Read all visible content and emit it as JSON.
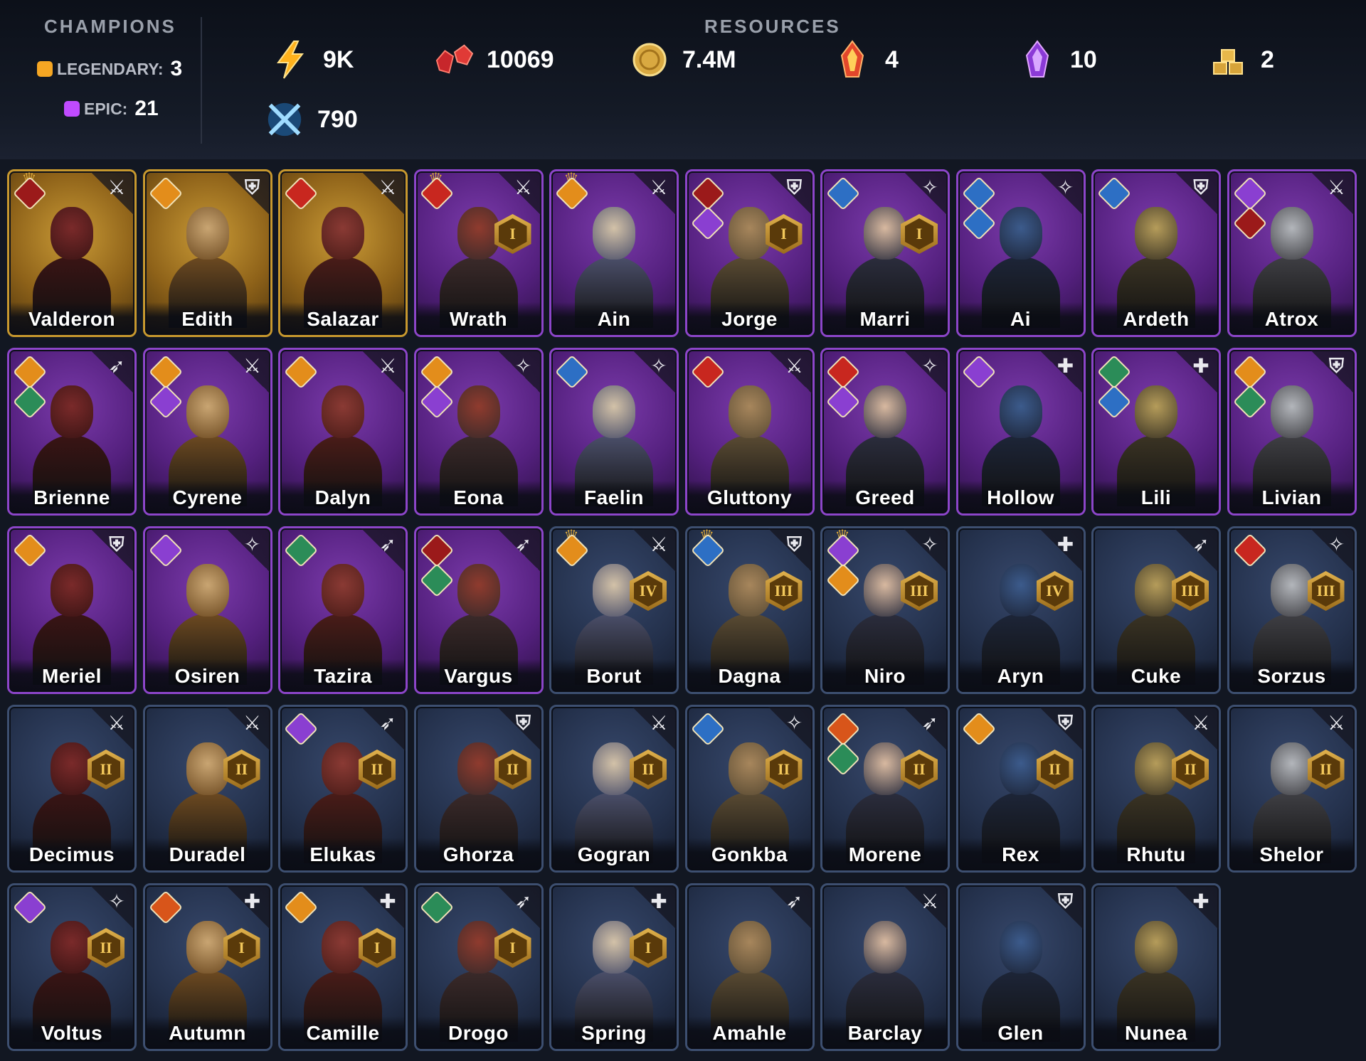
{
  "header": {
    "champions_title": "CHAMPIONS",
    "resources_title": "RESOURCES",
    "legendary": {
      "label": "LEGENDARY:",
      "count": "3",
      "color": "#f5a623"
    },
    "epic": {
      "label": "EPIC:",
      "count": "21",
      "color": "#c04bff"
    },
    "resources": [
      {
        "icon": "energy-bolt-icon",
        "value": "9K"
      },
      {
        "icon": "ruby-gems-icon",
        "value": "10069"
      },
      {
        "icon": "gold-coin-icon",
        "value": "7.4M"
      },
      {
        "icon": "fire-shard-icon",
        "value": "4"
      },
      {
        "icon": "void-shard-icon",
        "value": "10"
      },
      {
        "icon": "gold-bars-icon",
        "value": "2"
      },
      {
        "icon": "arena-swords-icon",
        "value": "790"
      }
    ]
  },
  "colors": {
    "legendary": "#c7982e",
    "epic": "#8c45c9",
    "rare": "#3d4f70"
  },
  "champions": [
    {
      "name": "Valderon",
      "rarity": "legendary",
      "role": "attack",
      "factions": [
        "red-demon"
      ],
      "crown": true,
      "rank": ""
    },
    {
      "name": "Edith",
      "rarity": "legendary",
      "role": "defense",
      "factions": [
        "orange"
      ],
      "crown": false,
      "rank": ""
    },
    {
      "name": "Salazar",
      "rarity": "legendary",
      "role": "attack",
      "factions": [
        "red"
      ],
      "crown": false,
      "rank": ""
    },
    {
      "name": "Wrath",
      "rarity": "epic",
      "role": "attack",
      "factions": [
        "red"
      ],
      "crown": true,
      "rank": "I"
    },
    {
      "name": "Ain",
      "rarity": "epic",
      "role": "attack",
      "factions": [
        "orange"
      ],
      "crown": true,
      "rank": ""
    },
    {
      "name": "Jorge",
      "rarity": "epic",
      "role": "defense",
      "factions": [
        "red-demon",
        "purple"
      ],
      "crown": false,
      "rank": "I"
    },
    {
      "name": "Marri",
      "rarity": "epic",
      "role": "support",
      "factions": [
        "blue"
      ],
      "crown": false,
      "rank": "I"
    },
    {
      "name": "Ai",
      "rarity": "epic",
      "role": "support",
      "factions": [
        "blue",
        "blue"
      ],
      "crown": false,
      "rank": ""
    },
    {
      "name": "Ardeth",
      "rarity": "epic",
      "role": "defense",
      "factions": [
        "blue"
      ],
      "crown": false,
      "rank": ""
    },
    {
      "name": "Atrox",
      "rarity": "epic",
      "role": "attack",
      "factions": [
        "purple",
        "red-demon"
      ],
      "crown": false,
      "rank": ""
    },
    {
      "name": "Brienne",
      "rarity": "epic",
      "role": "ranged",
      "factions": [
        "orange",
        "green"
      ],
      "crown": false,
      "rank": ""
    },
    {
      "name": "Cyrene",
      "rarity": "epic",
      "role": "attack",
      "factions": [
        "orange",
        "purple"
      ],
      "crown": false,
      "rank": ""
    },
    {
      "name": "Dalyn",
      "rarity": "epic",
      "role": "attack",
      "factions": [
        "orange"
      ],
      "crown": false,
      "rank": ""
    },
    {
      "name": "Eona",
      "rarity": "epic",
      "role": "support",
      "factions": [
        "orange",
        "purple"
      ],
      "crown": false,
      "rank": ""
    },
    {
      "name": "Faelin",
      "rarity": "epic",
      "role": "support",
      "factions": [
        "blue"
      ],
      "crown": false,
      "rank": ""
    },
    {
      "name": "Gluttony",
      "rarity": "epic",
      "role": "attack",
      "factions": [
        "red"
      ],
      "crown": false,
      "rank": ""
    },
    {
      "name": "Greed",
      "rarity": "epic",
      "role": "support",
      "factions": [
        "red",
        "purple"
      ],
      "crown": false,
      "rank": ""
    },
    {
      "name": "Hollow",
      "rarity": "epic",
      "role": "healer",
      "factions": [
        "purple"
      ],
      "crown": false,
      "rank": ""
    },
    {
      "name": "Lili",
      "rarity": "epic",
      "role": "healer",
      "factions": [
        "green",
        "blue"
      ],
      "crown": false,
      "rank": ""
    },
    {
      "name": "Livian",
      "rarity": "epic",
      "role": "defense",
      "factions": [
        "orange",
        "green"
      ],
      "crown": false,
      "rank": ""
    },
    {
      "name": "Meriel",
      "rarity": "epic",
      "role": "defense",
      "factions": [
        "orange"
      ],
      "crown": false,
      "rank": ""
    },
    {
      "name": "Osiren",
      "rarity": "epic",
      "role": "support",
      "factions": [
        "purple"
      ],
      "crown": false,
      "rank": ""
    },
    {
      "name": "Tazira",
      "rarity": "epic",
      "role": "ranged",
      "factions": [
        "green"
      ],
      "crown": false,
      "rank": ""
    },
    {
      "name": "Vargus",
      "rarity": "epic",
      "role": "ranged",
      "factions": [
        "red-demon",
        "green"
      ],
      "crown": false,
      "rank": ""
    },
    {
      "name": "Borut",
      "rarity": "rare",
      "role": "attack",
      "factions": [
        "orange"
      ],
      "crown": true,
      "rank": "IV"
    },
    {
      "name": "Dagna",
      "rarity": "rare",
      "role": "defense",
      "factions": [
        "blue"
      ],
      "crown": true,
      "rank": "III"
    },
    {
      "name": "Niro",
      "rarity": "rare",
      "role": "support",
      "factions": [
        "purple",
        "orange"
      ],
      "crown": true,
      "rank": "III"
    },
    {
      "name": "Aryn",
      "rarity": "rare",
      "role": "healer",
      "factions": [],
      "crown": false,
      "rank": "IV"
    },
    {
      "name": "Cuke",
      "rarity": "rare",
      "role": "ranged",
      "factions": [],
      "crown": false,
      "rank": "III"
    },
    {
      "name": "Sorzus",
      "rarity": "rare",
      "role": "support",
      "factions": [
        "red"
      ],
      "crown": false,
      "rank": "III"
    },
    {
      "name": "Decimus",
      "rarity": "rare",
      "role": "attack",
      "factions": [],
      "crown": false,
      "rank": "II"
    },
    {
      "name": "Duradel",
      "rarity": "rare",
      "role": "attack",
      "factions": [],
      "crown": false,
      "rank": "II"
    },
    {
      "name": "Elukas",
      "rarity": "rare",
      "role": "ranged",
      "factions": [
        "purple"
      ],
      "crown": false,
      "rank": "II"
    },
    {
      "name": "Ghorza",
      "rarity": "rare",
      "role": "defense",
      "factions": [],
      "crown": false,
      "rank": "II"
    },
    {
      "name": "Gogran",
      "rarity": "rare",
      "role": "attack",
      "factions": [],
      "crown": false,
      "rank": "II"
    },
    {
      "name": "Gonkba",
      "rarity": "rare",
      "role": "support",
      "factions": [
        "blue"
      ],
      "crown": false,
      "rank": "II"
    },
    {
      "name": "Morene",
      "rarity": "rare",
      "role": "ranged",
      "factions": [
        "orange-fire",
        "green"
      ],
      "crown": false,
      "rank": "II"
    },
    {
      "name": "Rex",
      "rarity": "rare",
      "role": "defense",
      "factions": [
        "orange"
      ],
      "crown": false,
      "rank": "II"
    },
    {
      "name": "Rhutu",
      "rarity": "rare",
      "role": "attack",
      "factions": [],
      "crown": false,
      "rank": "II"
    },
    {
      "name": "Shelor",
      "rarity": "rare",
      "role": "attack",
      "factions": [],
      "crown": false,
      "rank": "II"
    },
    {
      "name": "Voltus",
      "rarity": "rare",
      "role": "support",
      "factions": [
        "purple"
      ],
      "crown": false,
      "rank": "II"
    },
    {
      "name": "Autumn",
      "rarity": "rare",
      "role": "healer",
      "factions": [
        "orange-fire"
      ],
      "crown": false,
      "rank": "I"
    },
    {
      "name": "Camille",
      "rarity": "rare",
      "role": "healer",
      "factions": [
        "orange"
      ],
      "crown": false,
      "rank": "I"
    },
    {
      "name": "Drogo",
      "rarity": "rare",
      "role": "ranged",
      "factions": [
        "green"
      ],
      "crown": false,
      "rank": "I"
    },
    {
      "name": "Spring",
      "rarity": "rare",
      "role": "healer",
      "factions": [],
      "crown": false,
      "rank": "I"
    },
    {
      "name": "Amahle",
      "rarity": "rare",
      "role": "ranged",
      "factions": [],
      "crown": false,
      "rank": ""
    },
    {
      "name": "Barclay",
      "rarity": "rare",
      "role": "attack",
      "factions": [],
      "crown": false,
      "rank": ""
    },
    {
      "name": "Glen",
      "rarity": "rare",
      "role": "defense",
      "factions": [],
      "crown": false,
      "rank": ""
    },
    {
      "name": "Nunea",
      "rarity": "rare",
      "role": "healer",
      "factions": [],
      "crown": false,
      "rank": ""
    }
  ]
}
